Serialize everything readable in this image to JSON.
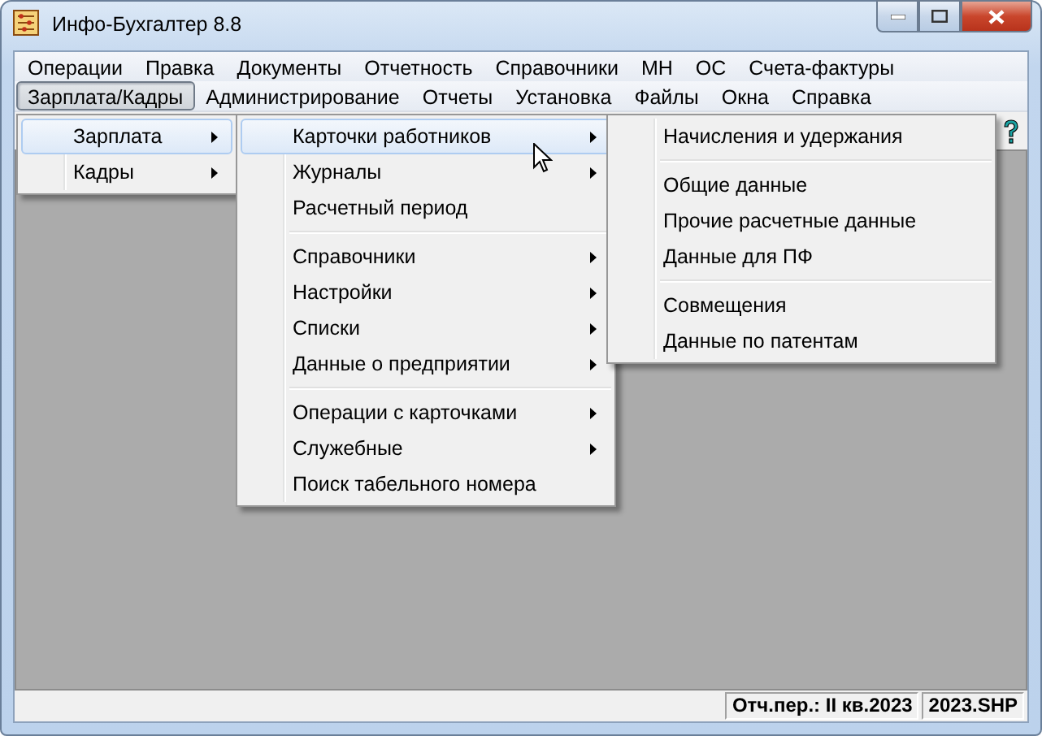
{
  "window": {
    "title": "Инфо-Бухгалтер 8.8"
  },
  "menu_bar_rows": [
    [
      {
        "label": "Операции",
        "selected": false
      },
      {
        "label": "Правка",
        "selected": false
      },
      {
        "label": "Документы",
        "selected": false
      },
      {
        "label": "Отчетность",
        "selected": false
      },
      {
        "label": "Справочники",
        "selected": false
      },
      {
        "label": "МН",
        "selected": false
      },
      {
        "label": "ОС",
        "selected": false
      },
      {
        "label": "Счета-фактуры",
        "selected": false
      }
    ],
    [
      {
        "label": "Зарплата/Кадры",
        "selected": true
      },
      {
        "label": "Администрирование",
        "selected": false
      },
      {
        "label": "Отчеты",
        "selected": false
      },
      {
        "label": "Установка",
        "selected": false
      },
      {
        "label": "Файлы",
        "selected": false
      },
      {
        "label": "Окна",
        "selected": false
      },
      {
        "label": "Справка",
        "selected": false
      }
    ]
  ],
  "menus": [
    {
      "items": [
        {
          "kind": "item",
          "label": "Зарплата",
          "submenu": true,
          "selected": true
        },
        {
          "kind": "item",
          "label": "Кадры",
          "submenu": true,
          "selected": false
        }
      ]
    },
    {
      "items": [
        {
          "kind": "item",
          "label": "Карточки работников",
          "submenu": true,
          "selected": true
        },
        {
          "kind": "item",
          "label": "Журналы",
          "submenu": true,
          "selected": false
        },
        {
          "kind": "item",
          "label": "Расчетный период",
          "submenu": false,
          "selected": false
        },
        {
          "kind": "separator"
        },
        {
          "kind": "item",
          "label": "Справочники",
          "submenu": true,
          "selected": false
        },
        {
          "kind": "item",
          "label": "Настройки",
          "submenu": true,
          "selected": false
        },
        {
          "kind": "item",
          "label": "Списки",
          "submenu": true,
          "selected": false
        },
        {
          "kind": "item",
          "label": "Данные о предприятии",
          "submenu": true,
          "selected": false
        },
        {
          "kind": "separator"
        },
        {
          "kind": "item",
          "label": "Операции с карточками",
          "submenu": true,
          "selected": false
        },
        {
          "kind": "item",
          "label": "Служебные",
          "submenu": true,
          "selected": false
        },
        {
          "kind": "item",
          "label": "Поиск табельного номера",
          "submenu": false,
          "selected": false
        }
      ]
    },
    {
      "items": [
        {
          "kind": "item",
          "label": "Начисления и удержания",
          "submenu": false,
          "selected": false
        },
        {
          "kind": "separator"
        },
        {
          "kind": "item",
          "label": "Общие данные",
          "submenu": false,
          "selected": false
        },
        {
          "kind": "item",
          "label": "Прочие расчетные данные",
          "submenu": false,
          "selected": false
        },
        {
          "kind": "item",
          "label": "Данные для ПФ",
          "submenu": false,
          "selected": false
        },
        {
          "kind": "separator"
        },
        {
          "kind": "item",
          "label": "Совмещения",
          "submenu": false,
          "selected": false
        },
        {
          "kind": "item",
          "label": "Данные по патентам",
          "submenu": false,
          "selected": false
        }
      ]
    }
  ],
  "status_bar": {
    "panels": [
      "Отч.пер.: II кв.2023",
      "2023.SHP"
    ]
  }
}
